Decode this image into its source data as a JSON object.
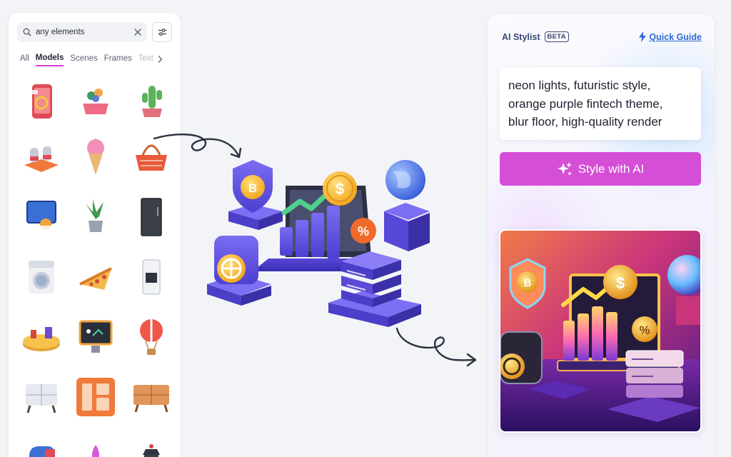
{
  "search": {
    "value": "any elements",
    "icons": {
      "search": "search-icon",
      "clear": "close-icon",
      "filter": "sliders-icon"
    }
  },
  "tabs": [
    {
      "label": "All",
      "active": false
    },
    {
      "label": "Models",
      "active": true
    },
    {
      "label": "Scenes",
      "active": false
    },
    {
      "label": "Frames",
      "active": false
    },
    {
      "label": "Text",
      "active": false
    }
  ],
  "models": [
    "phone-gift-model",
    "flower-basket-model",
    "cactus-model",
    "sneakers-model",
    "ice-cream-model",
    "shopping-basket-model",
    "basketball-hoop-model",
    "potted-plant-model",
    "refrigerator-model",
    "washing-machine-model",
    "pizza-slice-model",
    "water-dispenser-model",
    "festive-table-model",
    "monitor-board-model",
    "hot-air-balloon-model",
    "dresser-model",
    "orange-cabinet-model",
    "wooden-drawer-model",
    "mailbox-model",
    "lotus-model",
    "lantern-model"
  ],
  "stylist": {
    "title": "AI Stylist",
    "badge": "BETA",
    "guide_label": "Quick Guide",
    "prompt_lines": [
      "neon lights, futuristic style,",
      "orange purple fintech theme,",
      "blur floor, high-quality render"
    ],
    "button_label": "Style with AI"
  },
  "colors": {
    "accent": "#d44fd6",
    "tab_underline": "#cd3fd0",
    "link": "#2f6bd6",
    "badge": "#3a4a73"
  }
}
